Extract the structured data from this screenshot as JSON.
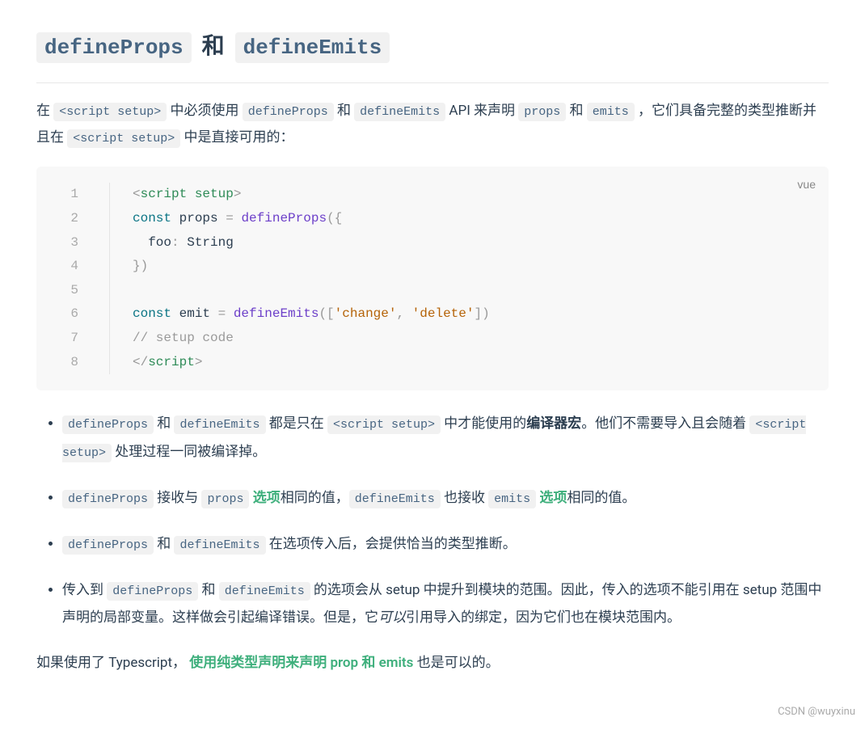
{
  "heading": {
    "code1": "defineProps",
    "conj": "和",
    "code2": "defineEmits"
  },
  "intro": {
    "t1": "在 ",
    "c1": "<script setup>",
    "t2": " 中必须使用 ",
    "c2": "defineProps",
    "t3": " 和 ",
    "c3": "defineEmits",
    "t4": " API 来声明 ",
    "c4": "props",
    "t5": " 和 ",
    "c5": "emits",
    "t6": " ，它们具备完整的类型推断并且在 ",
    "c6": "<script setup>",
    "t7": " 中是直接可用的："
  },
  "code": {
    "lang": "vue",
    "lines": [
      {
        "n": "1",
        "segs": [
          {
            "c": "tok-punct",
            "t": "<"
          },
          {
            "c": "tok-tag",
            "t": "script setup"
          },
          {
            "c": "tok-punct",
            "t": ">"
          }
        ]
      },
      {
        "n": "2",
        "segs": [
          {
            "c": "tok-kw",
            "t": "const"
          },
          {
            "c": "tok-var",
            "t": " props "
          },
          {
            "c": "tok-punct",
            "t": "= "
          },
          {
            "c": "tok-fn",
            "t": "defineProps"
          },
          {
            "c": "tok-punct",
            "t": "({"
          }
        ]
      },
      {
        "n": "3",
        "segs": [
          {
            "c": "tok-var",
            "t": "  foo"
          },
          {
            "c": "tok-punct",
            "t": ": "
          },
          {
            "c": "tok-var",
            "t": "String"
          }
        ]
      },
      {
        "n": "4",
        "segs": [
          {
            "c": "tok-punct",
            "t": "})"
          }
        ]
      },
      {
        "n": "5",
        "segs": [
          {
            "c": "tok-var",
            "t": ""
          }
        ]
      },
      {
        "n": "6",
        "segs": [
          {
            "c": "tok-kw",
            "t": "const"
          },
          {
            "c": "tok-var",
            "t": " emit "
          },
          {
            "c": "tok-punct",
            "t": "= "
          },
          {
            "c": "tok-fn",
            "t": "defineEmits"
          },
          {
            "c": "tok-punct",
            "t": "(["
          },
          {
            "c": "tok-str",
            "t": "'change'"
          },
          {
            "c": "tok-punct",
            "t": ", "
          },
          {
            "c": "tok-str",
            "t": "'delete'"
          },
          {
            "c": "tok-punct",
            "t": "])"
          }
        ]
      },
      {
        "n": "7",
        "segs": [
          {
            "c": "tok-cmt",
            "t": "// setup code"
          }
        ]
      },
      {
        "n": "8",
        "segs": [
          {
            "c": "tok-punct",
            "t": "</"
          },
          {
            "c": "tok-tag",
            "t": "script"
          },
          {
            "c": "tok-punct",
            "t": ">"
          }
        ]
      }
    ]
  },
  "bullets": [
    {
      "parts": [
        {
          "type": "code",
          "t": "defineProps"
        },
        {
          "type": "text",
          "t": " 和 "
        },
        {
          "type": "code",
          "t": "defineEmits"
        },
        {
          "type": "text",
          "t": " 都是只在 "
        },
        {
          "type": "code",
          "t": "<script setup>"
        },
        {
          "type": "text",
          "t": " 中才能使用的"
        },
        {
          "type": "bold",
          "t": "编译器宏"
        },
        {
          "type": "text",
          "t": "。他们不需要导入且会随着 "
        },
        {
          "type": "code",
          "t": "<script setup>"
        },
        {
          "type": "text",
          "t": " 处理过程一同被编译掉。"
        }
      ]
    },
    {
      "parts": [
        {
          "type": "code",
          "t": "defineProps"
        },
        {
          "type": "text",
          "t": " 接收与 "
        },
        {
          "type": "code",
          "t": "props"
        },
        {
          "type": "text",
          "t": " "
        },
        {
          "type": "link",
          "t": "选项"
        },
        {
          "type": "text",
          "t": "相同的值，"
        },
        {
          "type": "code",
          "t": "defineEmits"
        },
        {
          "type": "text",
          "t": " 也接收 "
        },
        {
          "type": "code",
          "t": "emits"
        },
        {
          "type": "text",
          "t": " "
        },
        {
          "type": "link",
          "t": "选项"
        },
        {
          "type": "text",
          "t": "相同的值。"
        }
      ]
    },
    {
      "parts": [
        {
          "type": "code",
          "t": "defineProps"
        },
        {
          "type": "text",
          "t": " 和 "
        },
        {
          "type": "code",
          "t": "defineEmits"
        },
        {
          "type": "text",
          "t": " 在选项传入后，会提供恰当的类型推断。"
        }
      ]
    },
    {
      "parts": [
        {
          "type": "text",
          "t": "传入到 "
        },
        {
          "type": "code",
          "t": "defineProps"
        },
        {
          "type": "text",
          "t": " 和 "
        },
        {
          "type": "code",
          "t": "defineEmits"
        },
        {
          "type": "text",
          "t": " 的选项会从 setup 中提升到模块的范围。因此，传入的选项不能引用在 setup 范围中声明的局部变量。这样做会引起编译错误。但是，它"
        },
        {
          "type": "em",
          "t": "可以"
        },
        {
          "type": "text",
          "t": "引用导入的绑定，因为它们也在模块范围内。"
        }
      ]
    }
  ],
  "tail": {
    "t1": "如果使用了 Typescript，",
    "link": "使用纯类型声明来声明 prop 和 emits",
    "t2": " 也是可以的。"
  },
  "credit": "CSDN @wuyxinu"
}
